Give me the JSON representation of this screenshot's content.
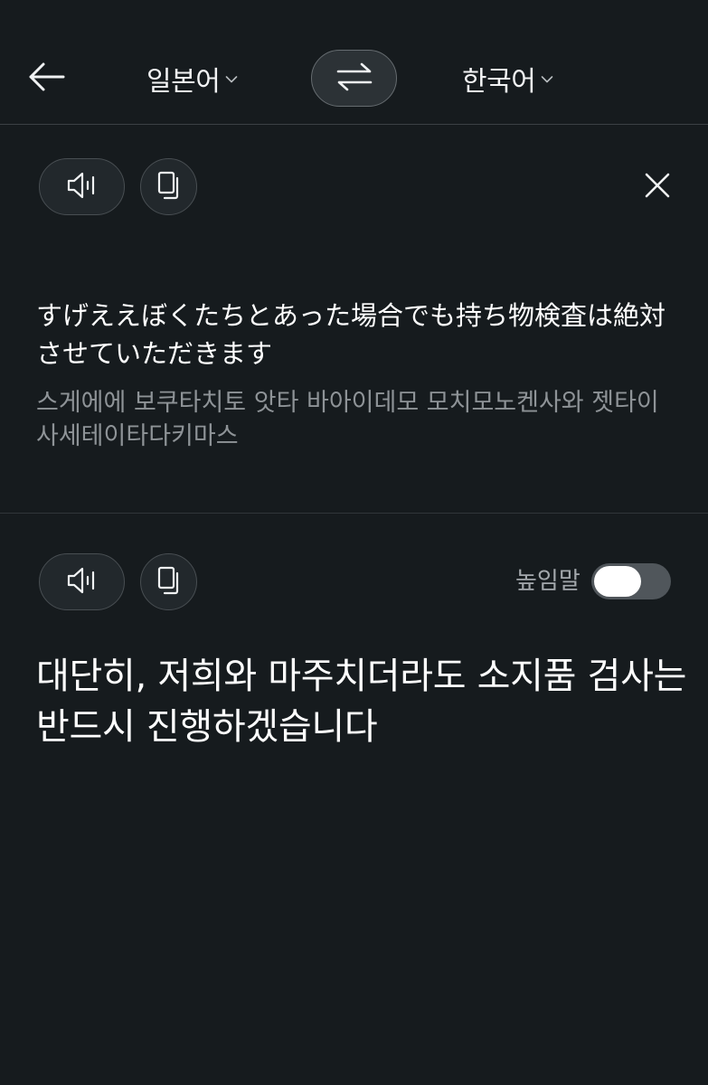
{
  "header": {
    "back_icon": "arrow-left-icon",
    "source_language": "일본어",
    "target_language": "한국어",
    "dropdown_icon": "chevron-down-icon",
    "swap_icon": "swap-arrows-icon"
  },
  "source_panel": {
    "speak_icon": "speaker-icon",
    "copy_icon": "copy-icon",
    "close_icon": "close-icon",
    "text": "すげええぼくたちとあった場合でも持ち物検査は絶対させていただきます",
    "pronunciation": "스게에에 보쿠타치토 앗타 바아이데모 모치모노켄사와 젯타이 사세테이타다키마스"
  },
  "target_panel": {
    "speak_icon": "speaker-icon",
    "copy_icon": "copy-icon",
    "honorific_label": "높임말",
    "honorific_enabled": false,
    "text": "대단히, 저희와 마주치더라도 소지품 검사는 반드시 진행하겠습니다"
  },
  "colors": {
    "background": "#161b1e",
    "button_bg": "#22282c",
    "secondary_text": "#8e9397"
  }
}
